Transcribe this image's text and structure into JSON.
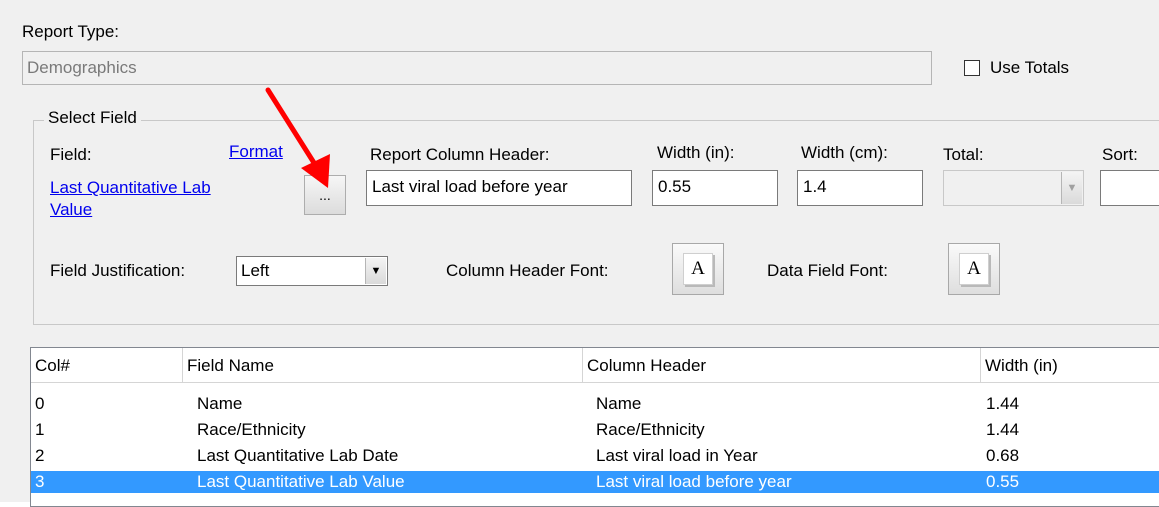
{
  "report_type": {
    "label": "Report Type:",
    "value": "Demographics"
  },
  "use_totals": {
    "label": "Use Totals",
    "checked": false
  },
  "select_field": {
    "group_label": "Select Field",
    "field_label": "Field:",
    "format_link": "Format",
    "field_link_line1": "Last Quantitative Lab",
    "field_link_line2": "Value",
    "browse_button": "...",
    "report_column_header_label": "Report Column Header:",
    "report_column_header_value": "Last viral load before year",
    "width_in_label": "Width (in):",
    "width_in_value": "0.55",
    "width_cm_label": "Width (cm):",
    "width_cm_value": "1.4",
    "total_label": "Total:",
    "total_value": "",
    "sort_label": "Sort:",
    "sort_value": "",
    "field_justification_label": "Field Justification:",
    "field_justification_value": "Left",
    "column_header_font_label": "Column Header Font:",
    "data_field_font_label": "Data Field Font:",
    "font_button_glyph": "A"
  },
  "table": {
    "columns": [
      "Col#",
      "Field Name",
      "Column Header",
      "Width (in)"
    ],
    "rows": [
      {
        "col": "0",
        "field_name": "Name",
        "column_header": "Name",
        "width": "1.44",
        "selected": false
      },
      {
        "col": "1",
        "field_name": "Race/Ethnicity",
        "column_header": "Race/Ethnicity",
        "width": "1.44",
        "selected": false
      },
      {
        "col": "2",
        "field_name": "Last Quantitative Lab Date",
        "column_header": "Last viral load in Year",
        "width": "0.68",
        "selected": false
      },
      {
        "col": "3",
        "field_name": "Last Quantitative Lab Value",
        "column_header": "Last viral load before year",
        "width": "0.55",
        "selected": true
      }
    ]
  },
  "annotation": {
    "arrow_color": "#ff0000",
    "target": "browse-button"
  },
  "colors": {
    "selection": "#3399ff",
    "link": "#0000ee",
    "panel": "#f0f0f0"
  }
}
